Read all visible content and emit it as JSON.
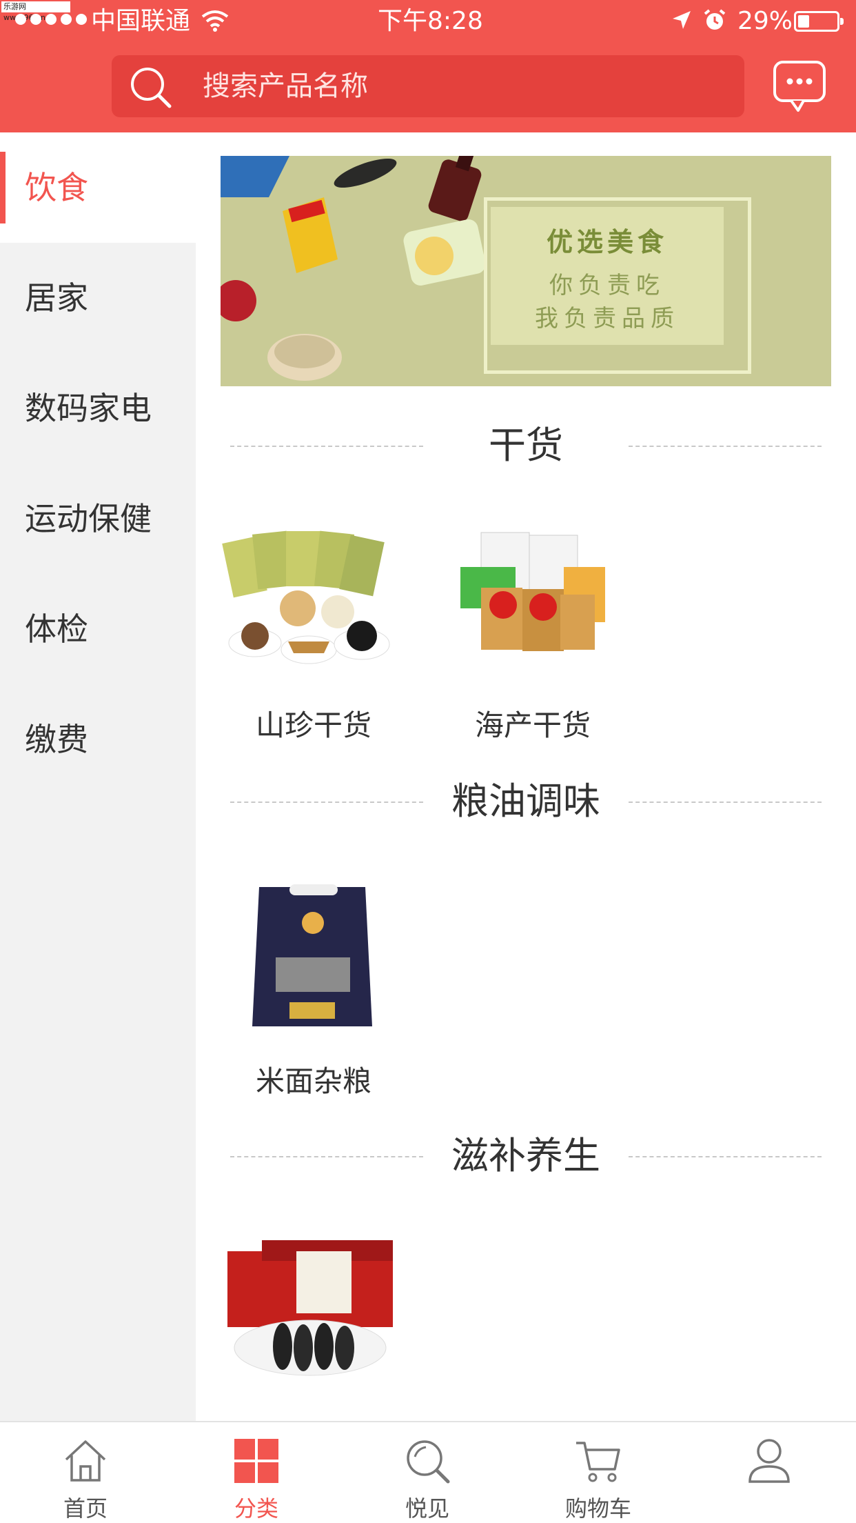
{
  "watermark": "乐游网 www.962.net",
  "status_bar": {
    "carrier": "中国联通",
    "time": "下午8:28",
    "battery": "29%",
    "battery_level": 0.29
  },
  "search": {
    "placeholder": "搜索产品名称"
  },
  "sidebar": {
    "items": [
      {
        "label": "饮食",
        "active": true
      },
      {
        "label": "居家"
      },
      {
        "label": "数码家电"
      },
      {
        "label": "运动保健"
      },
      {
        "label": "体检"
      },
      {
        "label": "缴费"
      }
    ]
  },
  "banner": {
    "title": "优选美食",
    "line1": "你负责吃",
    "line2": "我负责品质"
  },
  "sections": [
    {
      "title": "干货",
      "items": [
        {
          "label": "山珍干货"
        },
        {
          "label": "海产干货"
        }
      ]
    },
    {
      "title": "粮油调味",
      "items": [
        {
          "label": "米面杂粮"
        }
      ]
    },
    {
      "title": "滋补养生",
      "items": [
        {
          "label": ""
        }
      ]
    }
  ],
  "tabbar": {
    "items": [
      {
        "label": "首页",
        "icon": "home-icon"
      },
      {
        "label": "分类",
        "icon": "category-grid-icon",
        "active": true
      },
      {
        "label": "悦见",
        "icon": "discover-icon"
      },
      {
        "label": "购物车",
        "icon": "cart-icon"
      },
      {
        "label": "",
        "icon": "user-icon"
      }
    ]
  },
  "colors": {
    "accent": "#f2554f",
    "search_bg": "#e4413d",
    "sidebar_bg": "#f2f2f2"
  }
}
